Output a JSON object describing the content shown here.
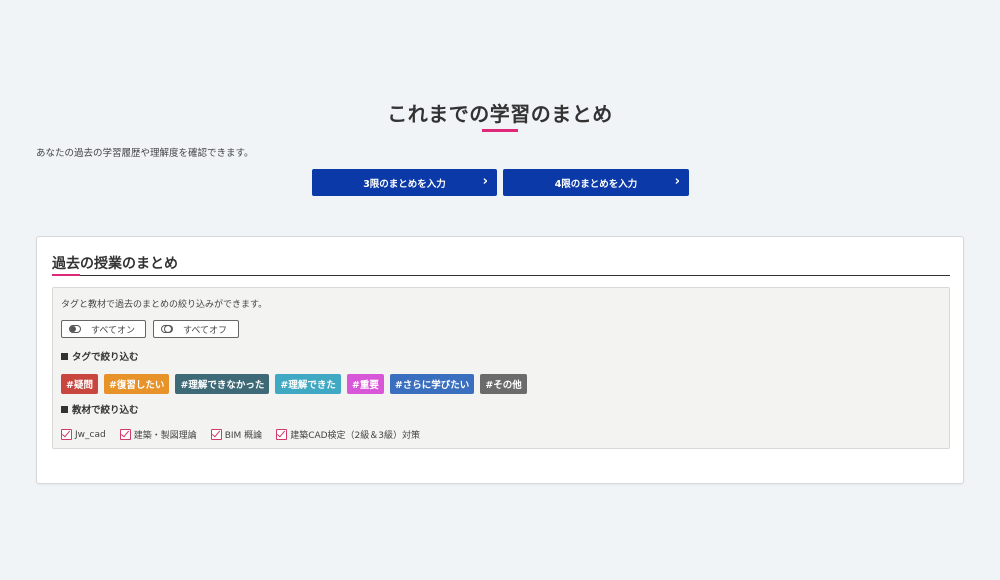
{
  "header": {
    "title": "これまでの学習のまとめ",
    "description": "あなたの過去の学習履歴や理解度を確認できます。"
  },
  "actions": {
    "class3_label": "3限のまとめを入力",
    "class4_label": "4限のまとめを入力",
    "chevron": "›"
  },
  "past_summary": {
    "title": "過去の授業のまとめ",
    "filter_description": "タグと教材で過去のまとめの絞り込みができます。",
    "toggle_all_on": "すべてオン",
    "toggle_all_off": "すべてオフ",
    "tag_section_label": "タグで絞り込む",
    "material_section_label": "教材で絞り込む",
    "tags": [
      {
        "label": "#疑問",
        "color": "#c9463f"
      },
      {
        "label": "#復習したい",
        "color": "#e8922a"
      },
      {
        "label": "#理解できなかった",
        "color": "#3e6a77"
      },
      {
        "label": "#理解できた",
        "color": "#3fa8c2"
      },
      {
        "label": "#重要",
        "color": "#d857d8"
      },
      {
        "label": "#さらに学びたい",
        "color": "#3a6fc0"
      },
      {
        "label": "#その他",
        "color": "#6b6b6b"
      }
    ],
    "materials": [
      {
        "label": "Jw_cad",
        "checked": true
      },
      {
        "label": "建築・製図理論",
        "checked": true
      },
      {
        "label": "BIM 概論",
        "checked": true
      },
      {
        "label": "建築CAD検定（2級＆3級）対策",
        "checked": true
      }
    ]
  },
  "colors": {
    "accent": "#e0287a",
    "primary_button": "#0b3aa8",
    "background": "#f0f4f7"
  }
}
